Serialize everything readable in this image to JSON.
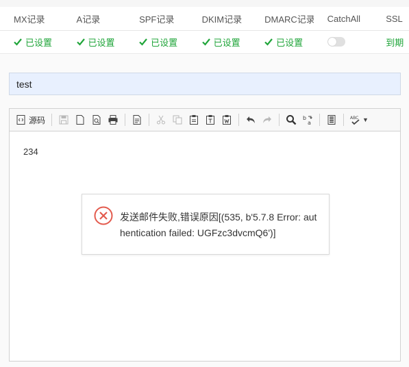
{
  "table": {
    "headers": [
      "MX记录",
      "A记录",
      "SPF记录",
      "DKIM记录",
      "DMARC记录",
      "CatchAll",
      "SSL"
    ],
    "row": {
      "mx": "已设置",
      "a": "已设置",
      "spf": "已设置",
      "dkim": "已设置",
      "dmarc": "已设置",
      "catchall_enabled": false,
      "ssl": "到期"
    }
  },
  "compose": {
    "subject": "test",
    "body": "234",
    "toolbar": {
      "source_label": "源码",
      "buttons": [
        "source",
        "save",
        "new-page",
        "preview",
        "print",
        "templates",
        "cut",
        "copy",
        "paste",
        "paste-text",
        "paste-word",
        "undo",
        "redo",
        "find",
        "replace",
        "select-all",
        "spellcheck"
      ]
    }
  },
  "error_message": {
    "text": "发送邮件失败,错误原因[(535, b'5.7.8 Error: authentication failed: UGFzc3dvcmQ6')]"
  },
  "colors": {
    "success": "#20a53a",
    "error": "#e35a4d",
    "subject_bg": "#e8f0fe"
  }
}
